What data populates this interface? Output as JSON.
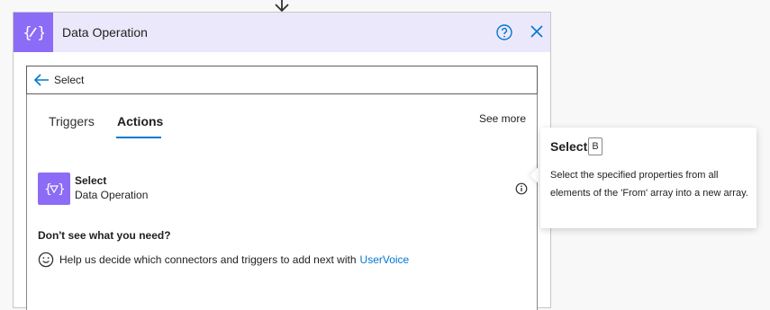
{
  "header": {
    "title": "Data Operation"
  },
  "search": {
    "value": "Select"
  },
  "tabs": [
    {
      "label": "Triggers"
    },
    {
      "label": "Actions",
      "active": true
    }
  ],
  "see_more": "See more",
  "action": {
    "name": "Select",
    "connector": "Data Operation"
  },
  "footer": {
    "question": "Don't see what you need?",
    "help_text": "Help us decide which connectors and triggers to add next with",
    "link": "UserVoice"
  },
  "tooltip": {
    "title": "Select",
    "key": "B",
    "description": "Select the specified properties from all elements of the 'From' array into a new array."
  },
  "colors": {
    "accent": "#8c6cf6",
    "header_bg": "#ece8fb",
    "link": "#0078d4"
  }
}
